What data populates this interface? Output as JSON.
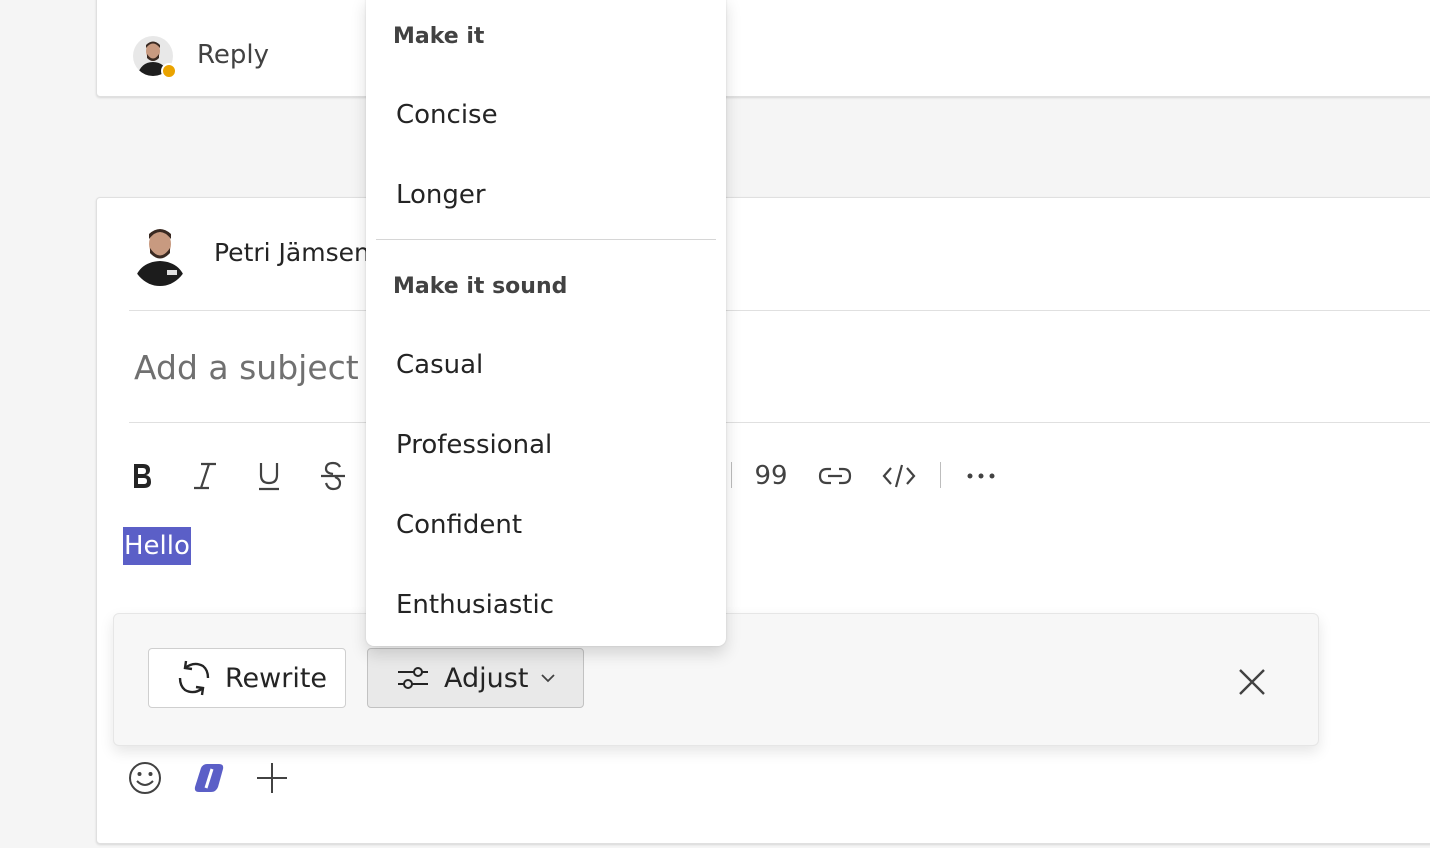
{
  "reply": {
    "label": "Reply"
  },
  "compose": {
    "author": "Petri Jämsen",
    "subject_placeholder": "Add a subject",
    "body_text": "Hello",
    "toolbar": {
      "quote_label": "99",
      "icons": [
        "bold-icon",
        "italic-icon",
        "underline-icon",
        "strikethrough-icon",
        "quote-icon",
        "link-icon",
        "code-icon",
        "more-icon"
      ]
    }
  },
  "copilot_bar": {
    "rewrite_label": "Rewrite",
    "adjust_label": "Adjust"
  },
  "adjust_menu": {
    "section1_header": "Make it",
    "section1_items": [
      "Concise",
      "Longer"
    ],
    "section2_header": "Make it sound",
    "section2_items": [
      "Casual",
      "Professional",
      "Confident",
      "Enthusiastic"
    ]
  },
  "colors": {
    "selection": "#5b5fc7",
    "presence_away": "#eaa300",
    "copilot_accent": "#5b5fc7"
  }
}
